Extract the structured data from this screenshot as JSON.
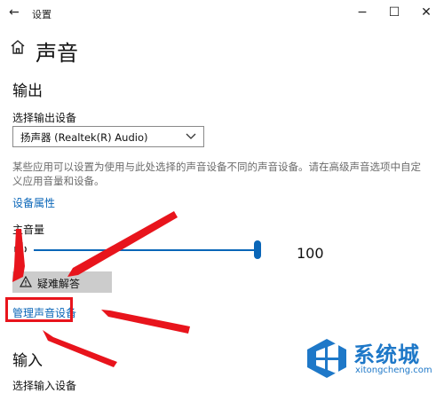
{
  "window": {
    "title": "设置",
    "back_icon": "back-arrow-icon",
    "controls": [
      "minimize-icon",
      "maximize-icon",
      "close-icon"
    ]
  },
  "page": {
    "icon": "home-icon",
    "title": "声音"
  },
  "output": {
    "heading": "输出",
    "device_label": "选择输出设备",
    "device_value": "扬声器 (Realtek(R) Audio)",
    "description": "某些应用可以设置为使用与此处选择的声音设备不同的声音设备。请在高级声音选项中自定义应用音量和设备。",
    "device_properties_link": "设备属性",
    "master_volume_label": "主音量",
    "volume_icon": "speaker-icon",
    "volume_value": "100",
    "volume_level_percent": 100,
    "troubleshoot_icon": "warning-icon",
    "troubleshoot_label": "疑难解答",
    "manage_devices_link": "管理声音设备"
  },
  "input": {
    "heading": "输入",
    "device_label": "选择输入设备"
  },
  "annotation": {
    "color": "#e8141c"
  },
  "watermark": {
    "logo_icon": "xitongcheng-logo-icon",
    "text": "系统城",
    "url": "xitongcheng.com"
  },
  "colors": {
    "accent": "#0a66b8",
    "annotation_red": "#e8141c",
    "button_gray": "#cccccc"
  }
}
